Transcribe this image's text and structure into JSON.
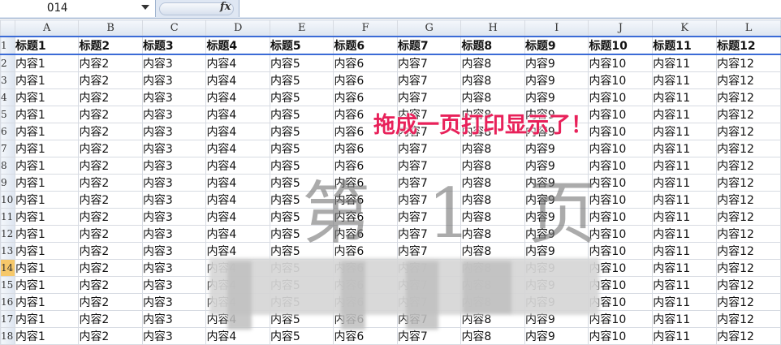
{
  "formula_bar": {
    "cell_ref": "O14",
    "fx_label": "fx",
    "formula_value": ""
  },
  "columns": [
    "A",
    "B",
    "C",
    "D",
    "E",
    "F",
    "G",
    "H",
    "I",
    "J",
    "K",
    "L"
  ],
  "rows": [
    {
      "num": "1",
      "cells": [
        "标题1",
        "标题2",
        "标题3",
        "标题4",
        "标题5",
        "标题6",
        "标题7",
        "标题8",
        "标题9",
        "标题10",
        "标题11",
        "标题12"
      ]
    },
    {
      "num": "2",
      "cells": [
        "内容1",
        "内容2",
        "内容3",
        "内容4",
        "内容5",
        "内容6",
        "内容7",
        "内容8",
        "内容9",
        "内容10",
        "内容11",
        "内容12"
      ]
    },
    {
      "num": "3",
      "cells": [
        "内容1",
        "内容2",
        "内容3",
        "内容4",
        "内容5",
        "内容6",
        "内容7",
        "内容8",
        "内容9",
        "内容10",
        "内容11",
        "内容12"
      ]
    },
    {
      "num": "4",
      "cells": [
        "内容1",
        "内容2",
        "内容3",
        "内容4",
        "内容5",
        "内容6",
        "内容7",
        "内容8",
        "内容9",
        "内容10",
        "内容11",
        "内容12"
      ]
    },
    {
      "num": "5",
      "cells": [
        "内容1",
        "内容2",
        "内容3",
        "内容4",
        "内容5",
        "内容6",
        "内容7",
        "内容8",
        "内容9",
        "内容10",
        "内容11",
        "内容12"
      ]
    },
    {
      "num": "6",
      "cells": [
        "内容1",
        "内容2",
        "内容3",
        "内容4",
        "内容5",
        "内容6",
        "内容7",
        "内容8",
        "内容9",
        "内容10",
        "内容11",
        "内容12"
      ]
    },
    {
      "num": "7",
      "cells": [
        "内容1",
        "内容2",
        "内容3",
        "内容4",
        "内容5",
        "内容6",
        "内容7",
        "内容8",
        "内容9",
        "内容10",
        "内容11",
        "内容12"
      ]
    },
    {
      "num": "8",
      "cells": [
        "内容1",
        "内容2",
        "内容3",
        "内容4",
        "内容5",
        "内容6",
        "内容7",
        "内容8",
        "内容9",
        "内容10",
        "内容11",
        "内容12"
      ]
    },
    {
      "num": "9",
      "cells": [
        "内容1",
        "内容2",
        "内容3",
        "内容4",
        "内容5",
        "内容6",
        "内容7",
        "内容8",
        "内容9",
        "内容10",
        "内容11",
        "内容12"
      ]
    },
    {
      "num": "10",
      "cells": [
        "内容1",
        "内容2",
        "内容3",
        "内容4",
        "内容5",
        "内容6",
        "内容7",
        "内容8",
        "内容9",
        "内容10",
        "内容11",
        "内容12"
      ]
    },
    {
      "num": "11",
      "cells": [
        "内容1",
        "内容2",
        "内容3",
        "内容4",
        "内容5",
        "内容6",
        "内容7",
        "内容8",
        "内容9",
        "内容10",
        "内容11",
        "内容12"
      ]
    },
    {
      "num": "12",
      "cells": [
        "内容1",
        "内容2",
        "内容3",
        "内容4",
        "内容5",
        "内容6",
        "内容7",
        "内容8",
        "内容9",
        "内容10",
        "内容11",
        "内容12"
      ]
    },
    {
      "num": "13",
      "cells": [
        "内容1",
        "内容2",
        "内容3",
        "内容4",
        "内容5",
        "内容6",
        "内容7",
        "内容8",
        "内容9",
        "内容10",
        "内容11",
        "内容12"
      ]
    },
    {
      "num": "14",
      "cells": [
        "内容1",
        "内容2",
        "内容3",
        "内容4",
        "内容5",
        "内容6",
        "内容7",
        "内容8",
        "内容9",
        "内容10",
        "内容11",
        "内容12"
      ]
    },
    {
      "num": "15",
      "cells": [
        "内容1",
        "内容2",
        "内容3",
        "内容4",
        "内容5",
        "内容6",
        "内容7",
        "内容8",
        "内容9",
        "内容10",
        "内容11",
        "内容12"
      ]
    },
    {
      "num": "16",
      "cells": [
        "内容1",
        "内容2",
        "内容3",
        "内容4",
        "内容5",
        "内容6",
        "内容7",
        "内容8",
        "内容9",
        "内容10",
        "内容11",
        "内容12"
      ]
    },
    {
      "num": "17",
      "cells": [
        "内容1",
        "内容2",
        "内容3",
        "内容4",
        "内容5",
        "内容6",
        "内容7",
        "内容8",
        "内容9",
        "内容10",
        "内容11",
        "内容12"
      ]
    },
    {
      "num": "18",
      "cells": [
        "内容1",
        "内容2",
        "内容3",
        "内容4",
        "内容5",
        "内容6",
        "内容7",
        "内容8",
        "内容9",
        "内容10",
        "内容11",
        "内容12"
      ]
    }
  ],
  "selected_row": "14",
  "watermark": "第 1 页",
  "annotation": "拖成一页打印显示了！",
  "colors": {
    "annotation": "#e8215a",
    "page_border": "#3b6bd6",
    "selected_row_header": "#f6c86a"
  }
}
